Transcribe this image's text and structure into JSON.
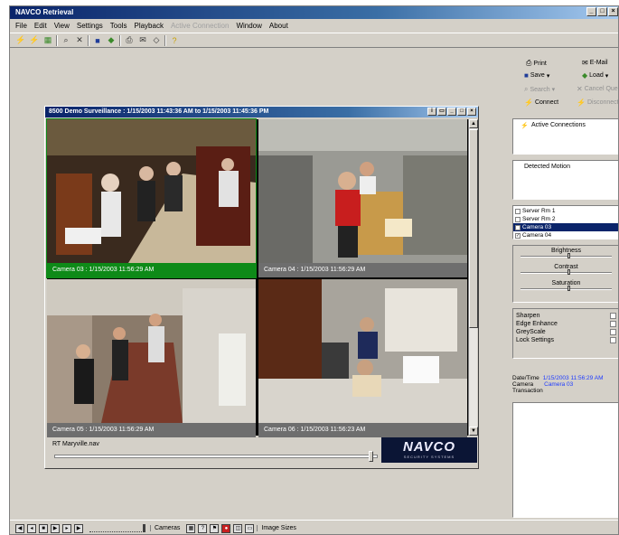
{
  "app": {
    "title": "NAVCO Retrieval"
  },
  "menu": [
    "File",
    "Edit",
    "View",
    "Settings",
    "Tools",
    "Playback",
    "Active Connection",
    "Window",
    "About"
  ],
  "menu_disabled": [
    "Active Connection"
  ],
  "child": {
    "title": "8500 Demo Surveillance : 1/15/2003 11:43:36 AM to 1/15/2003 11:45:36 PM",
    "cameras": [
      {
        "caption": "Camera 03 : 1/15/2003 11:56:29 AM",
        "active": true
      },
      {
        "caption": "Camera 04 : 1/15/2003 11:56:29 AM",
        "active": false
      },
      {
        "caption": "Camera 05 : 1/15/2003 11:56:29 AM",
        "active": false
      },
      {
        "caption": "Camera 06 : 1/15/2003 11:56:23 AM",
        "active": false
      }
    ],
    "file_name": "RT Maryville.nav",
    "logo_main": "NAVCO",
    "logo_sub": "SECURITY SYSTEMS"
  },
  "right_panel": {
    "print": "Print",
    "email": "E-Mail",
    "save": "Save",
    "load": "Load",
    "search": "Search",
    "cancel_query": "Cancel Que",
    "connect": "Connect",
    "disconnect": "Disconnect",
    "active_connections": "Active Connections",
    "detected_motion": "Detected Motion",
    "camera_list": [
      {
        "label": "Server Rm 1",
        "checked": false,
        "selected": false
      },
      {
        "label": "Server Rm 2",
        "checked": false,
        "selected": false
      },
      {
        "label": "Camera 03",
        "checked": true,
        "selected": true
      },
      {
        "label": "Camera 04",
        "checked": true,
        "selected": false
      }
    ],
    "brightness": "Brightness",
    "contrast": "Contrast",
    "saturation": "Saturation",
    "options": [
      "Sharpen",
      "Edge Enhance",
      "GreyScale",
      "Lock Settings"
    ],
    "datetime_label": "Date/Time",
    "datetime_value": "1/15/2003 11:56:29 AM",
    "camera_label": "Camera",
    "camera_value": "Camera 03",
    "transaction_label": "Transaction"
  },
  "statusbar": {
    "cameras": "Cameras",
    "image_sizes": "Image Sizes"
  }
}
